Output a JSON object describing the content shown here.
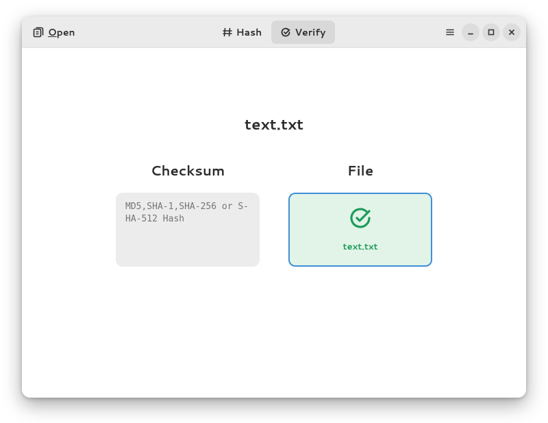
{
  "header": {
    "open_label": "Open",
    "tabs": {
      "hash_label": "Hash",
      "verify_label": "Verify"
    }
  },
  "main": {
    "filename_title": "text.txt",
    "checksum_heading": "Checksum",
    "file_heading": "File",
    "checksum_placeholder": "MD5,SHA-1,SHA-256 or S-\nHA-512 Hash",
    "dropped_filename": "text.txt",
    "status_color": "#1d9c5a"
  }
}
